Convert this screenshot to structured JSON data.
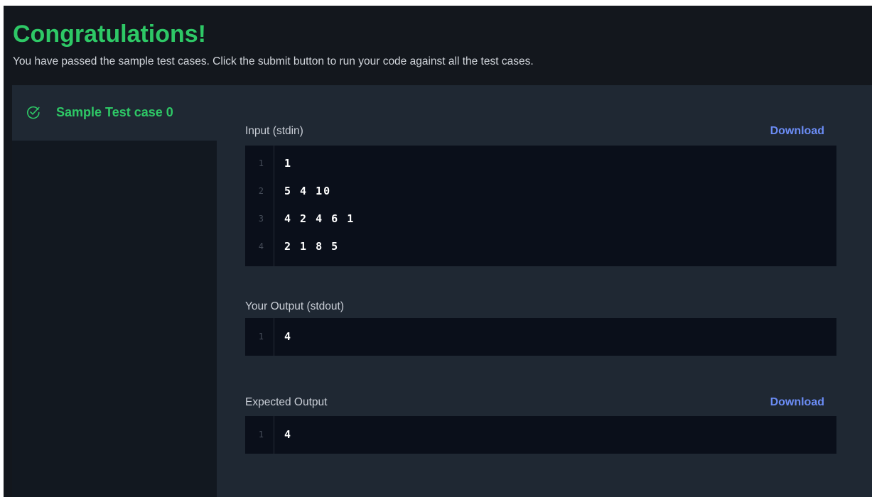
{
  "banner": {
    "title": "Congratulations!",
    "message": "You have passed the sample test cases. Click the submit button to run your code against all the test cases."
  },
  "sidebar": {
    "active_tab": {
      "label": "Sample Test case 0",
      "status": "passed",
      "icon": "check-circle-icon"
    }
  },
  "input": {
    "label": "Input (stdin)",
    "download_label": "Download",
    "lines": [
      {
        "num": "1",
        "text": "1"
      },
      {
        "num": "2",
        "text": "5 4 10"
      },
      {
        "num": "3",
        "text": "4 2 4 6 1"
      },
      {
        "num": "4",
        "text": "2 1 8 5"
      }
    ]
  },
  "your_output": {
    "label": "Your Output (stdout)",
    "lines": [
      {
        "num": "1",
        "text": "4"
      }
    ]
  },
  "expected_output": {
    "label": "Expected Output",
    "download_label": "Download",
    "lines": [
      {
        "num": "1",
        "text": "4"
      }
    ]
  },
  "colors": {
    "success": "#2ec866",
    "link": "#6b8cf5",
    "background": "#13171d",
    "panel": "#1f2833",
    "code_background": "#0a0f1a"
  }
}
